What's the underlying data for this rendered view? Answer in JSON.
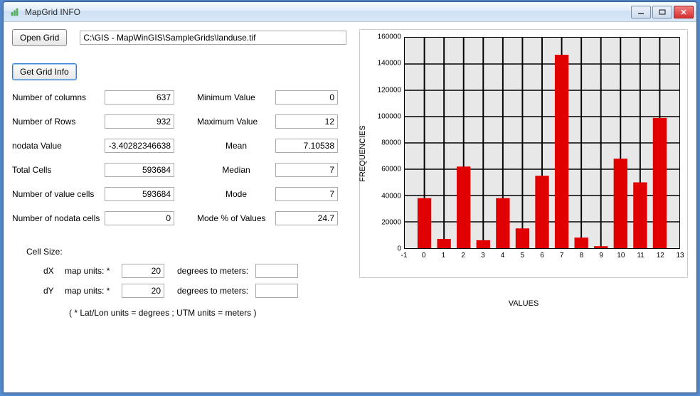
{
  "window": {
    "title": "MapGrid INFO"
  },
  "buttons": {
    "open": "Open Grid",
    "get_info": "Get Grid Info"
  },
  "path": "C:\\GIS - MapWinGIS\\SampleGrids\\landuse.tif",
  "stats": {
    "cols_label": "Number of columns",
    "cols": "637",
    "rows_label": "Number of  Rows",
    "rows": "932",
    "nodata_label": "nodata Value",
    "nodata": "-3.40282346638",
    "total_label": "Total Cells",
    "total": "593684",
    "valcells_label": "Number of  value cells",
    "valcells": "593684",
    "ndcells_label": "Number of  nodata cells",
    "ndcells": "0",
    "min_label": "Minimum Value",
    "min": "0",
    "max_label": "Maximum Value",
    "max": "12",
    "mean_label": "Mean",
    "mean": "7.10538",
    "median_label": "Median",
    "median": "7",
    "mode_label": "Mode",
    "mode": "7",
    "modepct_label": "Mode % of Values",
    "modepct": "24.7"
  },
  "cellsize": {
    "header": "Cell Size:",
    "dx_label": "dX",
    "dy_label": "dY",
    "units_label": "map units: *",
    "dx": "20",
    "dy": "20",
    "deg_label": "degrees to meters:",
    "dx_m": "",
    "dy_m": "",
    "footnote": "( * Lat/Lon units = degrees ;   UTM units = meters )"
  },
  "chart_labels": {
    "y": "FREQUENCIES",
    "x": "VALUES"
  },
  "chart_data": {
    "type": "bar",
    "title": "",
    "xlabel": "VALUES",
    "ylabel": "FREQUENCIES",
    "xlim": [
      -1,
      13
    ],
    "ylim": [
      0,
      160000
    ],
    "x_ticks": [
      -1,
      0,
      1,
      2,
      3,
      4,
      5,
      6,
      7,
      8,
      9,
      10,
      11,
      12,
      13
    ],
    "y_ticks": [
      0,
      20000,
      40000,
      60000,
      80000,
      100000,
      120000,
      140000,
      160000
    ],
    "categories": [
      0,
      1,
      2,
      3,
      4,
      5,
      6,
      7,
      8,
      9,
      10,
      11,
      12
    ],
    "values": [
      38000,
      7000,
      62000,
      6000,
      38000,
      15000,
      55000,
      147000,
      8000,
      1500,
      68000,
      50000,
      99000
    ]
  }
}
